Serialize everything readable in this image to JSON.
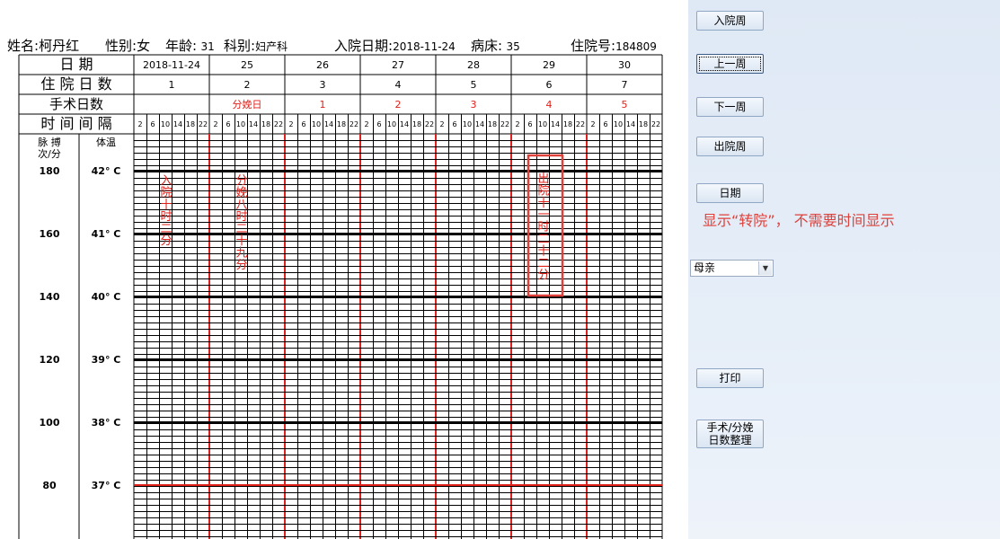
{
  "patient": {
    "name_label": "姓名:",
    "name": "柯丹红",
    "gender_label": "性别:",
    "gender": "女",
    "age_label": "年龄:",
    "age": "31",
    "dept_label": "科别:",
    "dept": "妇产科",
    "admit_label": "入院日期:",
    "admit_date": "2018-11-24",
    "bed_label": "病床:",
    "bed": "35",
    "id_label": "住院号:",
    "id": "184809"
  },
  "table": {
    "row_labels": [
      "日    期",
      "住 院 日 数",
      "手术日数",
      "时 间 间 隔"
    ],
    "dates": [
      "2018-11-24",
      "25",
      "26",
      "27",
      "28",
      "29",
      "30"
    ],
    "hospital_days": [
      "1",
      "2",
      "3",
      "4",
      "5",
      "6",
      "7"
    ],
    "surgery_days": [
      "",
      "分娩日",
      "1",
      "2",
      "3",
      "4",
      "5"
    ],
    "hours": [
      "2",
      "6",
      "10",
      "14",
      "18",
      "22"
    ],
    "pulse_header": [
      "脉 搏",
      "次/分"
    ],
    "temp_header": "体温",
    "pulse_scale": [
      "180",
      "160",
      "140",
      "120",
      "100",
      "80"
    ],
    "temp_scale": [
      "42° C",
      "41° C",
      "40° C",
      "39° C",
      "38° C",
      "37° C"
    ]
  },
  "annotations": [
    {
      "text": "入院十时二分"
    },
    {
      "text": "分娩八时二十九分"
    },
    {
      "text": "出院十一时二十二分",
      "highlighted": true
    }
  ],
  "buttons": {
    "admit_week": "入院周",
    "prev_week": "上一周",
    "next_week": "下一周",
    "discharge_week": "出院周",
    "date": "日期",
    "print": "打印",
    "surgery_days": "手术/分娩\n日数整理"
  },
  "note": "显示“转院”， 不需要时间显示",
  "select": {
    "value": "母亲"
  },
  "colors": {
    "red": "#e0201a",
    "accent_note": "#e0403a",
    "panel": "#dfe9f5"
  }
}
